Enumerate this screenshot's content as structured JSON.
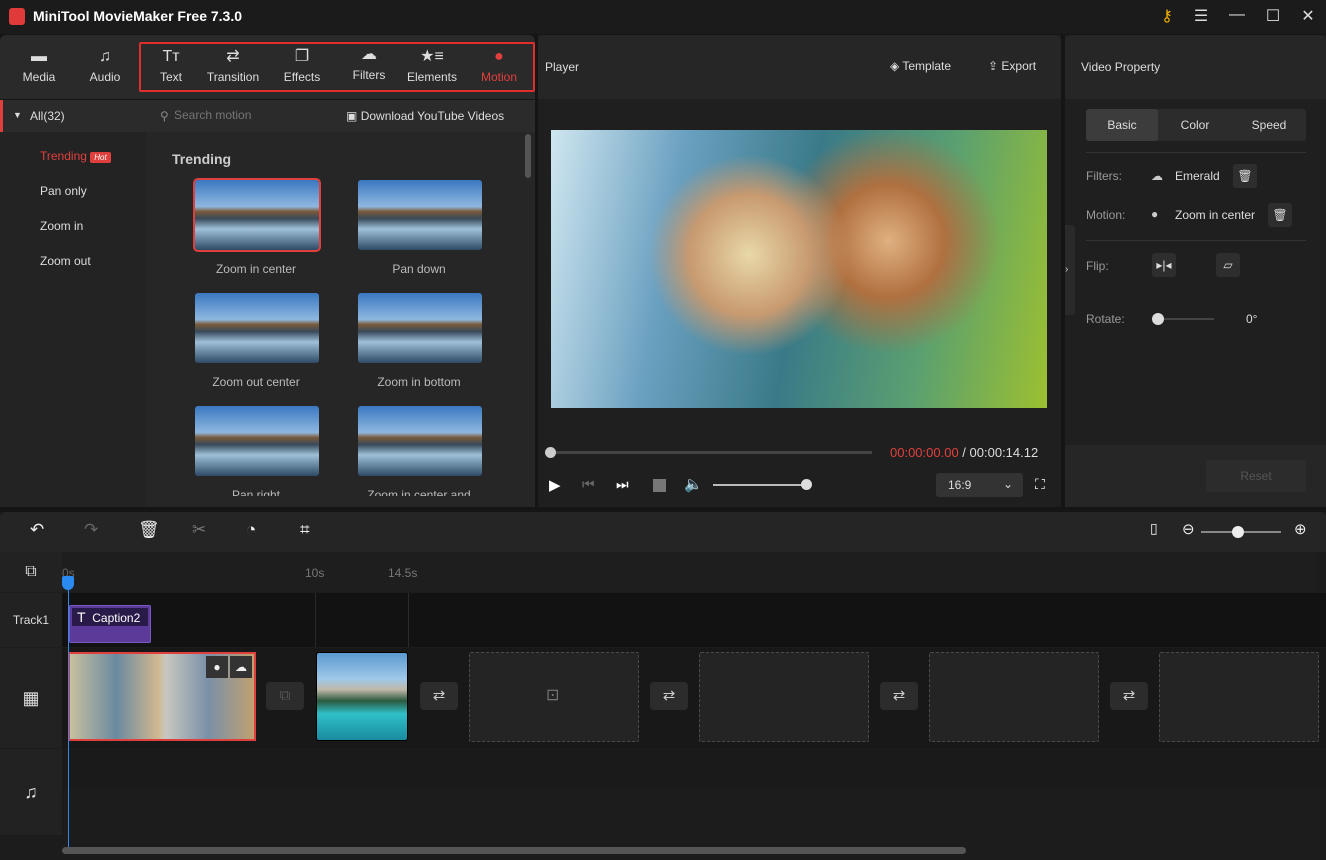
{
  "app": {
    "title": "MiniTool MovieMaker Free 7.3.0",
    "window_controls": [
      "key-icon",
      "menu-icon",
      "minimize-icon",
      "maximize-icon",
      "close-icon"
    ]
  },
  "tabs": [
    {
      "label": "Media",
      "icon": "folder-icon"
    },
    {
      "label": "Audio",
      "icon": "music-icon"
    },
    {
      "label": "Text",
      "icon": "text-icon"
    },
    {
      "label": "Transition",
      "icon": "swap-icon"
    },
    {
      "label": "Effects",
      "icon": "effects-icon"
    },
    {
      "label": "Filters",
      "icon": "filters-icon"
    },
    {
      "label": "Elements",
      "icon": "elements-icon"
    },
    {
      "label": "Motion",
      "icon": "motion-icon",
      "active": true
    }
  ],
  "accent": "#e0403d",
  "categories": {
    "all": "All(32)",
    "items": [
      {
        "label": "Trending",
        "badge": "Hot",
        "active": true
      },
      {
        "label": "Pan only"
      },
      {
        "label": "Zoom in"
      },
      {
        "label": "Zoom out"
      }
    ]
  },
  "search": {
    "placeholder": "Search motion",
    "download": "Download YouTube Videos"
  },
  "section": "Trending",
  "motions": [
    {
      "label": "Zoom in center",
      "selected": true
    },
    {
      "label": "Pan down"
    },
    {
      "label": "Zoom out center"
    },
    {
      "label": "Zoom in bottom"
    },
    {
      "label": "Pan right"
    },
    {
      "label": "Zoom in center and"
    }
  ],
  "player": {
    "title": "Player",
    "template": "Template",
    "export": "Export",
    "current_time": "00:00:00.00",
    "separator": " / ",
    "total_time": "00:00:14.12",
    "progress": 0,
    "volume": 1.0,
    "aspect": "16:9"
  },
  "property": {
    "title": "Video Property",
    "tabs": [
      "Basic",
      "Color",
      "Speed"
    ],
    "active_tab": "Basic",
    "filters_label": "Filters:",
    "filter_value": "Emerald",
    "motion_label": "Motion:",
    "motion_value": "Zoom in center",
    "flip_label": "Flip:",
    "rotate_label": "Rotate:",
    "rotate_value": "0°",
    "reset": "Reset"
  },
  "timeline": {
    "ruler": [
      "0s",
      "10s",
      "14.5s"
    ],
    "track1": "Track1",
    "caption": "Caption2",
    "zoom_level": 0.6
  }
}
